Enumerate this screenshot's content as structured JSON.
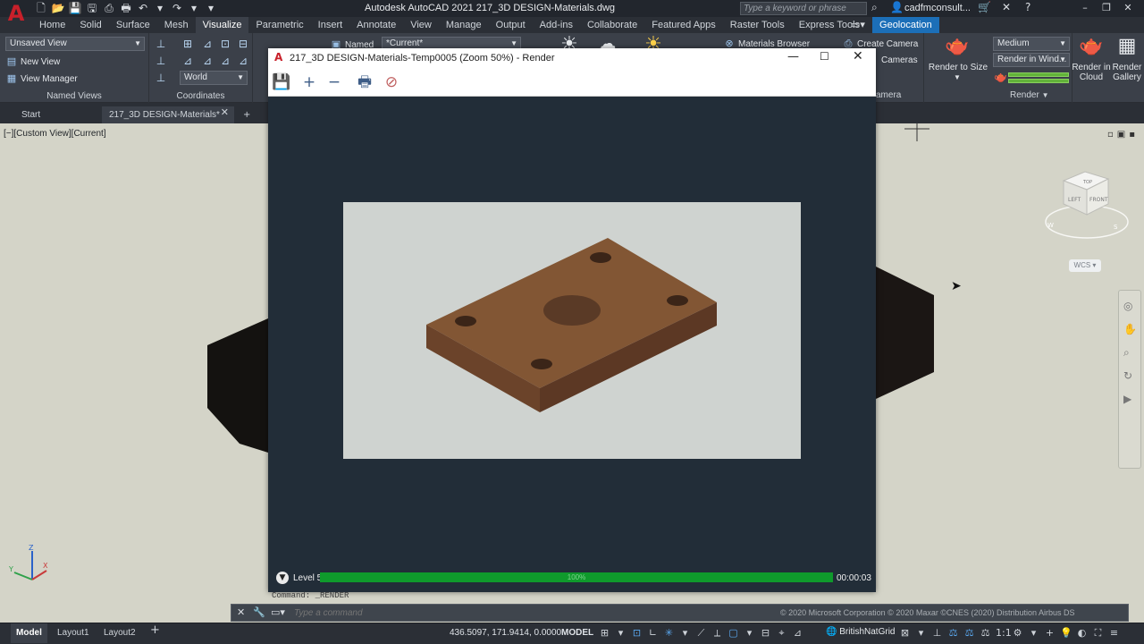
{
  "app": {
    "title": "Autodesk AutoCAD 2021    217_3D DESIGN-Materials.dwg",
    "search_placeholder": "Type a keyword or phrase",
    "user": "cadfmconsult...",
    "window_controls": [
      "–",
      "❐",
      "✕"
    ]
  },
  "ribbon_tabs": [
    "Home",
    "Solid",
    "Surface",
    "Mesh",
    "Visualize",
    "Parametric",
    "Insert",
    "Annotate",
    "View",
    "Manage",
    "Output",
    "Add-ins",
    "Collaborate",
    "Featured Apps",
    "Raster Tools",
    "Express Tools",
    "Geolocation"
  ],
  "active_tab": "Visualize",
  "ribbon": {
    "named_views": {
      "view_combo": "Unsaved View",
      "new_view": "New View",
      "view_manager": "View Manager",
      "label": "Named Views"
    },
    "coordinates": {
      "ucs_combo": "World",
      "label": "Coordinates"
    },
    "visual_styles": {
      "named": "Named",
      "current": "*Current*"
    },
    "materials": {
      "browser": "Materials Browser"
    },
    "camera": {
      "create": "Create Camera",
      "cameras": "Cameras",
      "label_partial": "amera"
    },
    "render": {
      "quality": "Medium",
      "destination": "Render in Wind...",
      "render_to_size": "Render to Size",
      "render_cloud": "Render in Cloud",
      "render_gallery": "Render Gallery",
      "label": "Render"
    }
  },
  "file_tabs": {
    "start": "Start",
    "document": "217_3D DESIGN-Materials*"
  },
  "viewport": {
    "label": "[−][Custom View][Current]",
    "wcs": "WCS",
    "cube_top": "TOP",
    "cube_left": "LEFT",
    "cube_front": "FRONT",
    "compass_w": "W",
    "compass_s": "S"
  },
  "render_window": {
    "title": "217_3D DESIGN-Materials-Temp0005 (Zoom 50%) - Render",
    "level": "Level 5",
    "progress": 1.0,
    "progress_label": "100%",
    "elapsed": "00:00:03"
  },
  "command": {
    "history": "Command: _RENDER",
    "placeholder": "Type a command",
    "attribution": "© 2020 Microsoft Corporation © 2020 Maxar ©CNES (2020) Distribution Airbus DS"
  },
  "status": {
    "layout_tabs": [
      "Model",
      "Layout1",
      "Layout2"
    ],
    "coords": "436.5097, 171.9414, 0.0000",
    "space": "MODEL",
    "workspace": "BritishNatGrid"
  },
  "colors": {
    "accent": "#1c6fb8",
    "progress": "#0f9a2c",
    "brand": "#c8202a"
  }
}
